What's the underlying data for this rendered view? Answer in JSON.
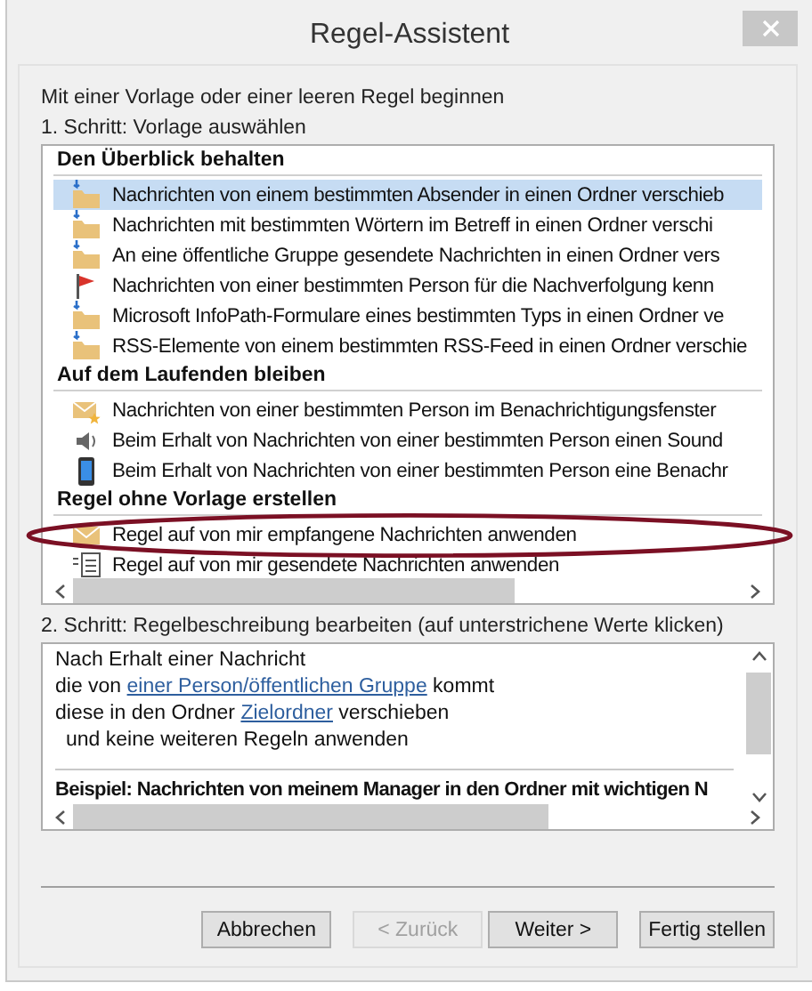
{
  "window": {
    "title": "Regel-Assistent"
  },
  "intro": "Mit einer Vorlage oder einer leeren Regel beginnen",
  "step1": {
    "label": "1. Schritt: Vorlage auswählen",
    "groups": [
      {
        "title": "Den Überblick behalten",
        "items": [
          {
            "kind": "folder",
            "text": "Nachrichten von einem bestimmten Absender in einen Ordner verschieb",
            "selected": true
          },
          {
            "kind": "folder",
            "text": "Nachrichten mit bestimmten Wörtern im Betreff in einen Ordner verschi",
            "selected": false
          },
          {
            "kind": "folder",
            "text": "An eine öffentliche Gruppe gesendete Nachrichten in einen Ordner vers",
            "selected": false
          },
          {
            "kind": "flag",
            "text": "Nachrichten von einer bestimmten Person für die Nachverfolgung kenn",
            "selected": false
          },
          {
            "kind": "folder",
            "text": "Microsoft InfoPath-Formulare eines bestimmten Typs in einen Ordner ve",
            "selected": false
          },
          {
            "kind": "folder",
            "text": "RSS-Elemente von einem bestimmten RSS-Feed in einen Ordner verschie",
            "selected": false
          }
        ]
      },
      {
        "title": "Auf dem Laufenden bleiben",
        "items": [
          {
            "kind": "alert",
            "text": "Nachrichten von einer bestimmten Person im Benachrichtigungsfenster",
            "selected": false
          },
          {
            "kind": "sound",
            "text": "Beim Erhalt von Nachrichten von einer bestimmten Person einen Sound",
            "selected": false
          },
          {
            "kind": "phone",
            "text": "Beim Erhalt von Nachrichten von einer bestimmten Person eine Benachr",
            "selected": false
          }
        ]
      },
      {
        "title": "Regel ohne Vorlage erstellen",
        "items": [
          {
            "kind": "envelope",
            "text": "Regel auf von mir empfangene Nachrichten anwenden",
            "selected": false
          },
          {
            "kind": "sent",
            "text": "Regel auf von mir gesendete Nachrichten anwenden",
            "selected": false
          }
        ]
      }
    ]
  },
  "annotation": {
    "kind": "ellipse"
  },
  "step2": {
    "label": "2. Schritt: Regelbeschreibung bearbeiten (auf unterstrichene Werte klicken)",
    "lines": [
      {
        "indent": false,
        "parts": [
          {
            "kind": "text",
            "text": "Nach Erhalt einer Nachricht"
          }
        ]
      },
      {
        "indent": false,
        "parts": [
          {
            "kind": "text",
            "text": "die von "
          },
          {
            "kind": "link",
            "text": "einer Person/öffentlichen Gruppe"
          },
          {
            "kind": "text",
            "text": " kommt"
          }
        ]
      },
      {
        "indent": false,
        "parts": [
          {
            "kind": "text",
            "text": "diese in den Ordner "
          },
          {
            "kind": "link",
            "text": "Zielordner"
          },
          {
            "kind": "text",
            "text": " verschieben"
          }
        ]
      },
      {
        "indent": true,
        "parts": [
          {
            "kind": "text",
            "text": "und keine weiteren Regeln anwenden"
          }
        ]
      }
    ],
    "example": "Beispiel: Nachrichten von meinem Manager in den Ordner mit wichtigen N"
  },
  "buttons": [
    {
      "label": "Abbrechen",
      "disabled": false
    },
    {
      "label": "< Zurück",
      "disabled": true
    },
    {
      "label": "Weiter >",
      "disabled": false
    },
    {
      "label": "Fertig stellen",
      "disabled": false
    }
  ]
}
